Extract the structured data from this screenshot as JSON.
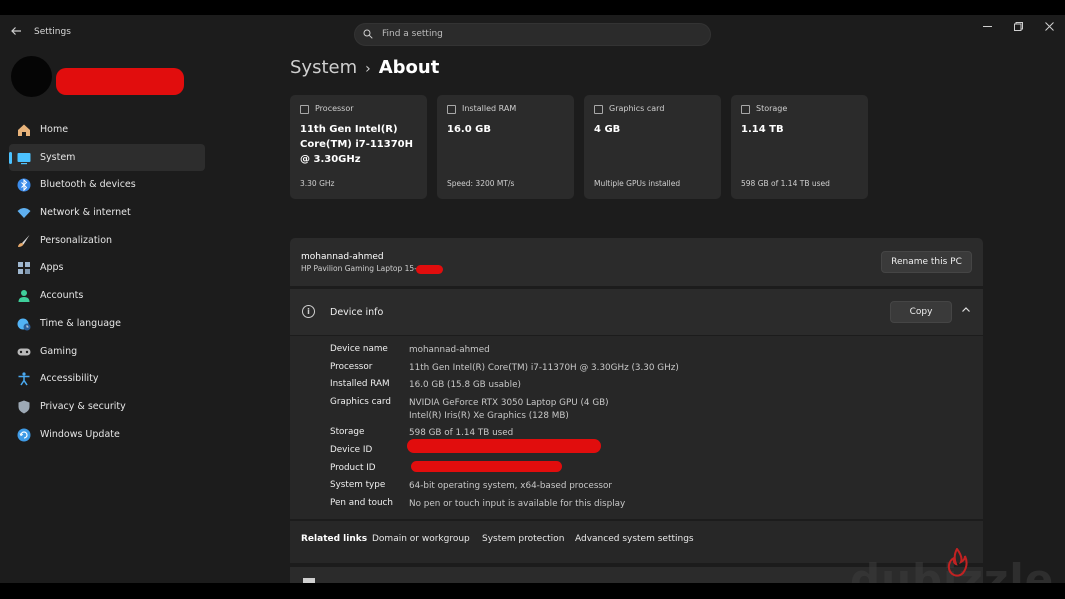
{
  "window": {
    "title": "Settings",
    "search_placeholder": "Find a setting"
  },
  "sidebar": {
    "items": [
      {
        "label": "Home",
        "icon": "home-icon",
        "color": "#e8b37a"
      },
      {
        "label": "System",
        "icon": "system-icon",
        "color": "#4cc2ff",
        "selected": true
      },
      {
        "label": "Bluetooth & devices",
        "icon": "bluetooth-icon",
        "color": "#3b8bea"
      },
      {
        "label": "Network & internet",
        "icon": "wifi-icon",
        "color": "#5fb0f0"
      },
      {
        "label": "Personalization",
        "icon": "brush-icon",
        "color": "#e6a96b"
      },
      {
        "label": "Apps",
        "icon": "apps-icon",
        "color": "#9fb7cf"
      },
      {
        "label": "Accounts",
        "icon": "person-icon",
        "color": "#3fcf9b"
      },
      {
        "label": "Time & language",
        "icon": "globe-clock-icon",
        "color": "#52b3f5"
      },
      {
        "label": "Gaming",
        "icon": "gamepad-icon",
        "color": "#b9b9b9"
      },
      {
        "label": "Accessibility",
        "icon": "accessibility-icon",
        "color": "#4aa9f0"
      },
      {
        "label": "Privacy & security",
        "icon": "shield-icon",
        "color": "#9da9b5"
      },
      {
        "label": "Windows Update",
        "icon": "update-icon",
        "color": "#3f9be6"
      }
    ]
  },
  "breadcrumb": {
    "parent": "System",
    "separator": "›",
    "current": "About"
  },
  "specs": [
    {
      "label": "Processor",
      "value": "11th Gen Intel(R) Core(TM) i7-11370H @ 3.30GHz",
      "sub": "3.30 GHz"
    },
    {
      "label": "Installed RAM",
      "value": "16.0 GB",
      "sub": "Speed: 3200 MT/s"
    },
    {
      "label": "Graphics card",
      "value": "4 GB",
      "sub": "Multiple GPUs installed"
    },
    {
      "label": "Storage",
      "value": "1.14 TB",
      "sub": "598 GB of 1.14 TB used"
    }
  ],
  "pc": {
    "name": "mohannad-ahmed",
    "model": "HP Pavilion Gaming Laptop 15-",
    "rename_label": "Rename this PC"
  },
  "device_info": {
    "title": "Device info",
    "copy_label": "Copy",
    "rows": [
      {
        "key": "Device name",
        "value": "mohannad-ahmed"
      },
      {
        "key": "Processor",
        "value": "11th Gen Intel(R) Core(TM) i7-11370H @ 3.30GHz (3.30 GHz)"
      },
      {
        "key": "Installed RAM",
        "value": "16.0 GB (15.8 GB usable)"
      },
      {
        "key": "Graphics card",
        "value": "NVIDIA GeForce RTX 3050 Laptop GPU (4 GB)",
        "value2": "Intel(R) Iris(R) Xe Graphics (128 MB)"
      },
      {
        "key": "Storage",
        "value": "598 GB of 1.14 TB used"
      },
      {
        "key": "Device ID",
        "value": ""
      },
      {
        "key": "Product ID",
        "value": ""
      },
      {
        "key": "System type",
        "value": "64-bit operating system, x64-based processor"
      },
      {
        "key": "Pen and touch",
        "value": "No pen or touch input is available for this display"
      }
    ]
  },
  "related": {
    "title": "Related links",
    "links": [
      "Domain or workgroup",
      "System protection",
      "Advanced system settings"
    ]
  },
  "watermark": "dubizzle",
  "colors": {
    "accent": "#4cc2ff",
    "redaction": "#e10d0d",
    "background": "#1c1c1c",
    "card": "#2b2b2b"
  }
}
